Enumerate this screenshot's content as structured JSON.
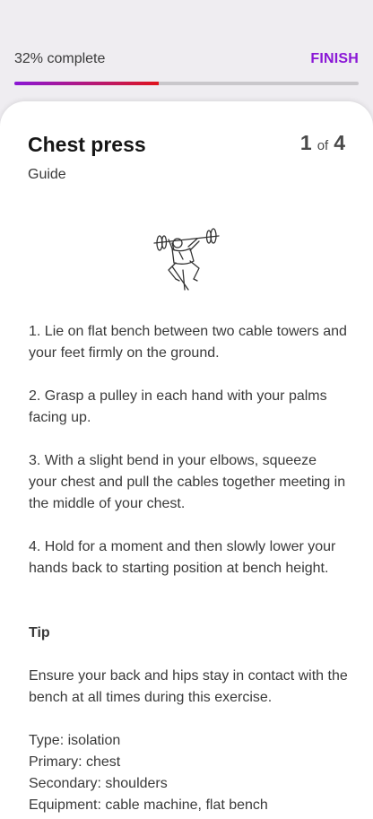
{
  "progress": {
    "label": "32% complete",
    "fraction": 0.42,
    "finish_label": "FINISH",
    "colors": {
      "start": "#8a17d6",
      "end": "#e0131b",
      "track": "#c9c7cb"
    }
  },
  "exercise": {
    "title": "Chest press",
    "index": "1",
    "of_label": "of",
    "total": "4",
    "subtitle": "Guide",
    "illustration_icon": "chest-press-illustration",
    "steps": [
      "1. Lie on flat bench between two cable towers and your feet firmly on the ground.",
      "2. Grasp a pulley in each hand with your palms facing up.",
      "3. With a slight bend in your elbows, squeeze your chest and pull the cables together meeting in the middle of your chest.",
      "4. Hold for a moment and then slowly lower your hands back to starting position at bench height."
    ],
    "tip_heading": "Tip",
    "tip_text": "Ensure your back and hips stay in contact with the bench at all times during this exercise.",
    "details": {
      "type": "Type: isolation",
      "primary": "Primary: chest",
      "secondary": "Secondary: shoulders",
      "equipment": "Equipment: cable machine, flat bench"
    }
  },
  "colors": {
    "accent": "#8a17d6",
    "sheet": "#ffffff",
    "background": "#efedf1"
  }
}
